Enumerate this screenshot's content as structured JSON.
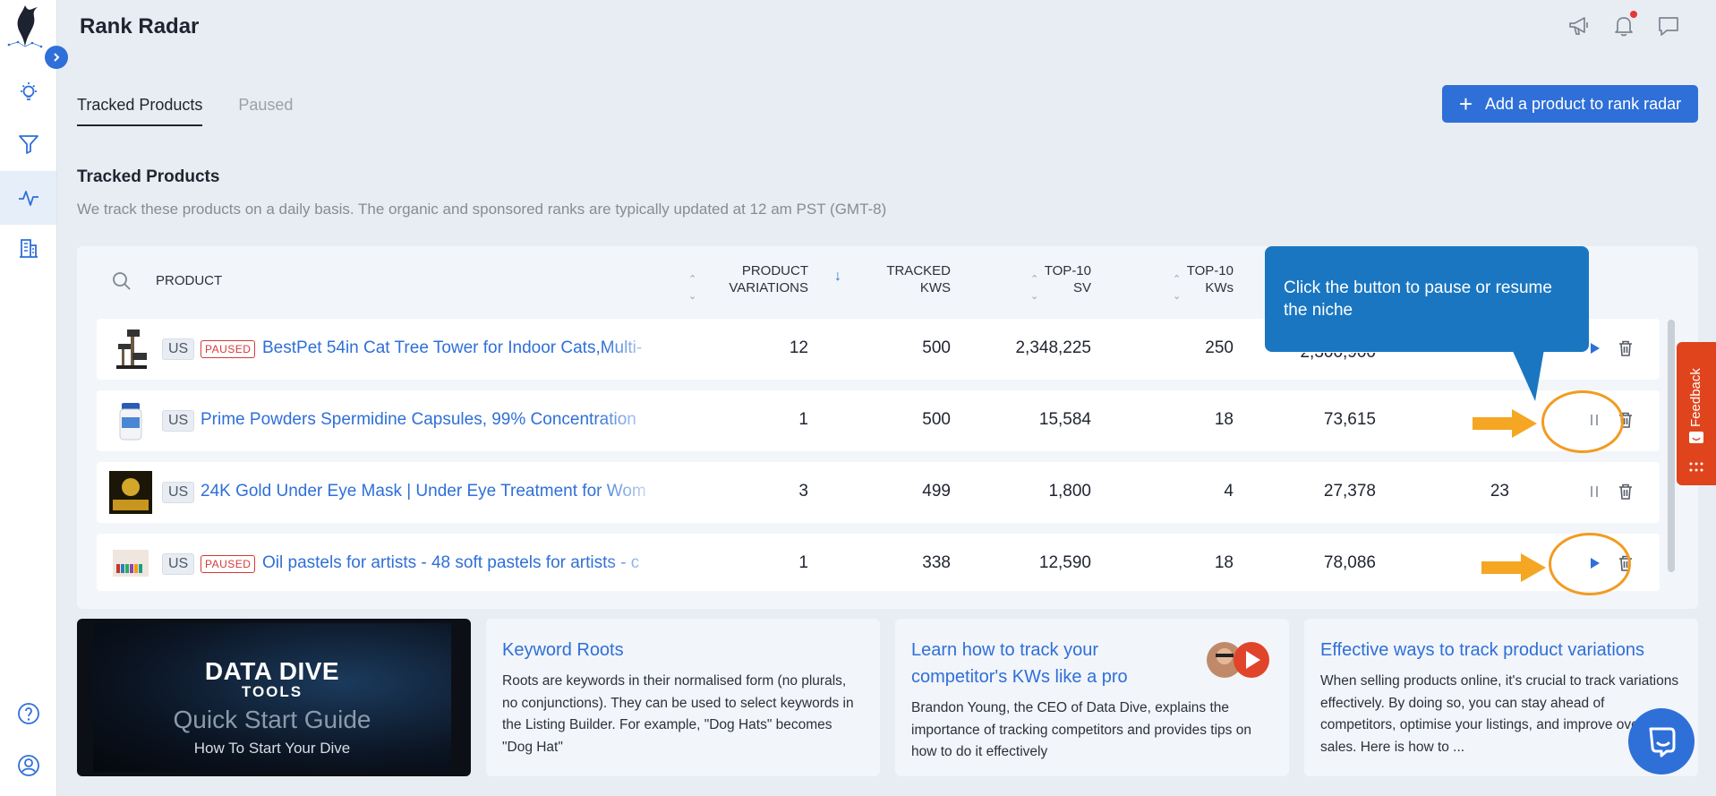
{
  "app": {
    "title": "Rank Radar"
  },
  "tabs": [
    {
      "label": "Tracked Products"
    },
    {
      "label": "Paused"
    }
  ],
  "add_button": {
    "label": "Add a product to rank radar"
  },
  "section": {
    "title": "Tracked Products",
    "description": "We track these products on a daily basis. The organic and sponsored ranks are typically updated at 12 am PST (GMT-8)"
  },
  "table": {
    "headers": {
      "product": "PRODUCT",
      "variations": [
        "PRODUCT",
        "VARIATIONS"
      ],
      "tracked": [
        "TRACKED",
        "KWS"
      ],
      "top10sv": [
        "TOP-10",
        "SV"
      ],
      "top10kws": [
        "TOP-10",
        "KWs"
      ]
    },
    "rows": [
      {
        "country": "US",
        "paused": true,
        "paused_label": "PAUSED",
        "name": "BestPet 54in Cat Tree Tower for Indoor Cats,Multi-",
        "variations": "12",
        "tracked": "500",
        "top10sv": "2,348,225",
        "top10kws": "250",
        "col6": "2,300,900",
        "col7": "",
        "action": "play"
      },
      {
        "country": "US",
        "paused": false,
        "paused_label": "",
        "name": "Prime Powders Spermidine Capsules, 99% Concentration",
        "variations": "1",
        "tracked": "500",
        "top10sv": "15,584",
        "top10kws": "18",
        "col6": "73,615",
        "col7": "",
        "action": "pause"
      },
      {
        "country": "US",
        "paused": false,
        "paused_label": "",
        "name": "24K Gold Under Eye Mask | Under Eye Treatment for Wom",
        "variations": "3",
        "tracked": "499",
        "top10sv": "1,800",
        "top10kws": "4",
        "col6": "27,378",
        "col7": "23",
        "action": "pause"
      },
      {
        "country": "US",
        "paused": true,
        "paused_label": "PAUSED",
        "name": "Oil pastels for artists - 48 soft pastels for artists - c",
        "variations": "1",
        "tracked": "338",
        "top10sv": "12,590",
        "top10kws": "18",
        "col6": "78,086",
        "col7": "",
        "action": "play"
      }
    ]
  },
  "tooltip": {
    "text": "Click the button to pause or resume the niche"
  },
  "feedback": {
    "label": "Feedback"
  },
  "video": {
    "line1": "DATA DIVE",
    "line2": "TOOLS",
    "line3": "Quick Start Guide",
    "line4": "How To Start Your Dive"
  },
  "cards": [
    {
      "title": "Keyword Roots",
      "text": "Roots are keywords in their normalised form (no plurals, no conjunctions). They can be used to select keywords in the Listing Builder. For example, \"Dog Hats\" becomes \"Dog Hat\""
    },
    {
      "title": "Learn how to track your competitor's KWs like a pro",
      "text": "Brandon Young, the CEO of Data Dive, explains the importance of tracking competitors and provides tips on how to do it effectively"
    },
    {
      "title": "Effective ways to track product variations",
      "text": "When selling products online, it's crucial to track variations effectively. By doing so, you can stay ahead of competitors, optimise your listings, and improve overall sales. Here is how to ..."
    }
  ],
  "icons": {
    "sidebar": [
      "bulb-icon",
      "filter-icon",
      "pulse-icon",
      "building-icon",
      "help-icon",
      "user-icon"
    ],
    "header": [
      "megaphone-icon",
      "bell-icon",
      "chat-icon"
    ]
  },
  "colors": {
    "accent": "#2f6fd8",
    "tooltip": "#1a76c1",
    "highlight": "#f29b22",
    "paused": "#d33a3a",
    "feedback": "#e0441d"
  }
}
